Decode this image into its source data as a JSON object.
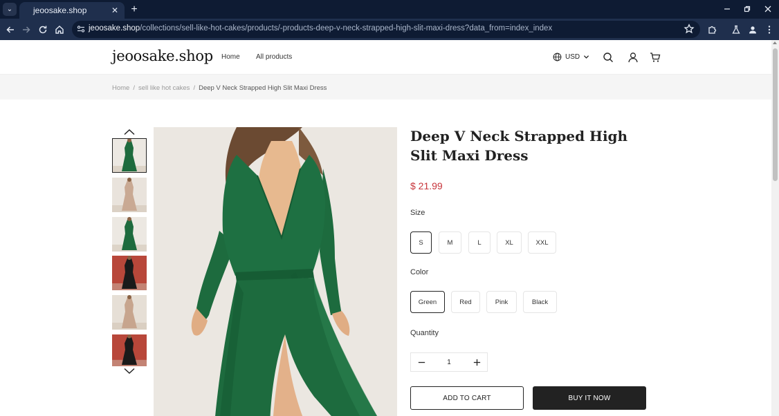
{
  "browser": {
    "tab_title": "jeoosake.shop",
    "url_host": "jeoosake.shop",
    "url_path": "/collections/sell-like-hot-cakes/products/-products-deep-v-neck-strapped-high-slit-maxi-dress?data_from=index_index"
  },
  "site": {
    "logo": "jeoosake.shop",
    "nav": [
      "Home",
      "All products"
    ],
    "currency": "USD"
  },
  "breadcrumb": {
    "items": [
      "Home",
      "sell like hot cakes"
    ],
    "current": "Deep V Neck Strapped High Slit Maxi Dress"
  },
  "product": {
    "title": "Deep V Neck Strapped High Slit Maxi Dress",
    "price": "$ 21.99",
    "size_label": "Size",
    "sizes": [
      "S",
      "M",
      "L",
      "XL",
      "XXL"
    ],
    "selected_size": "S",
    "color_label": "Color",
    "colors": [
      "Green",
      "Red",
      "Pink",
      "Black"
    ],
    "selected_color": "Green",
    "quantity_label": "Quantity",
    "quantity": "1",
    "add_to_cart": "ADD TO CART",
    "buy_now": "BUY IT NOW"
  },
  "thumbnails": [
    {
      "name": "green",
      "dress": "#1e6b3e",
      "bg": "#ece8e2",
      "selected": true
    },
    {
      "name": "pink",
      "dress": "#c9a993",
      "bg": "#e9e3dc",
      "selected": false
    },
    {
      "name": "green-2",
      "dress": "#1e6b3e",
      "bg": "#ece8e2",
      "selected": false
    },
    {
      "name": "black",
      "dress": "#1a1a1a",
      "bg": "#b8473a",
      "selected": false
    },
    {
      "name": "pink-2",
      "dress": "#c7a58e",
      "bg": "#e6dfd6",
      "selected": false
    },
    {
      "name": "black-2",
      "dress": "#1a1a1a",
      "bg": "#b8473a",
      "selected": false
    }
  ]
}
